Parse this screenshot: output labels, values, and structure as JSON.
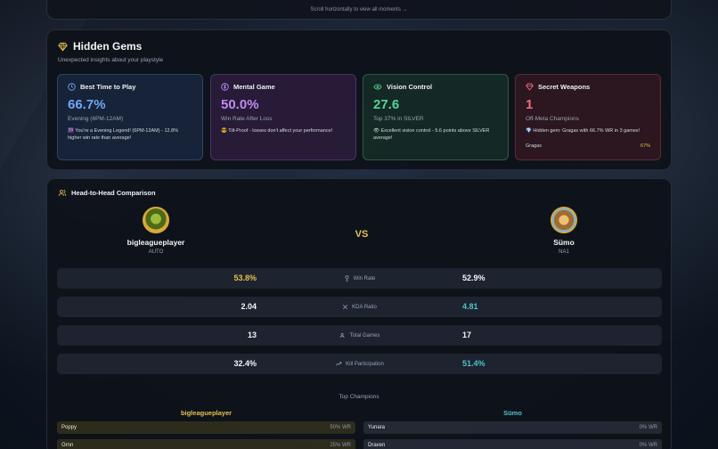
{
  "topbar": {
    "scroll_hint": "Scroll horizontally to view all moments →"
  },
  "gems": {
    "title": "Hidden Gems",
    "subtitle": "Unexpected insights about your playstyle",
    "cards": [
      {
        "title": "Best Time to Play",
        "value": "66.7%",
        "subtitle": "Evening (6PM-12AM)",
        "note": "🌆 You're a Evening Legend! (6PM-12AM) - 12.8% higher win rate than average!"
      },
      {
        "title": "Mental Game",
        "value": "50.0%",
        "subtitle": "Win Rate After Loss",
        "note": "😎 Tilt-Proof - losses don't affect your performance!"
      },
      {
        "title": "Vision Control",
        "value": "27.6",
        "subtitle": "Top 37% in SILVER",
        "note": "👁 Excellent vision control - 5.6 points above SILVER average!"
      },
      {
        "title": "Secret Weapons",
        "value": "1",
        "subtitle": "Off-Meta Champions",
        "note": "💎 Hidden gem: Gragas with 66.7% WR in 3 games!",
        "champion": "Gragas",
        "champion_wr": "67%"
      }
    ]
  },
  "h2h": {
    "title": "Head-to-Head Comparison",
    "vs": "VS",
    "player1": {
      "name": "bigleagueplayer",
      "region": "AUTO"
    },
    "player2": {
      "name": "Sümo",
      "region": "NA1"
    },
    "stats": [
      {
        "label": "Win Rate",
        "left": "53.8%",
        "right": "52.9%"
      },
      {
        "label": "KDA Ratio",
        "left": "2.04",
        "right": "4.81"
      },
      {
        "label": "Total Games",
        "left": "13",
        "right": "17"
      },
      {
        "label": "Kill Participation",
        "left": "32.4%",
        "right": "51.4%"
      }
    ],
    "top_champions_title": "Top Champions",
    "left_col_title": "bigleagueplayer",
    "right_col_title": "Sümo",
    "left_champs": [
      {
        "name": "Poppy",
        "wr": "50% WR"
      },
      {
        "name": "Ornn",
        "wr": "25% WR"
      }
    ],
    "right_champs": [
      {
        "name": "Yunara",
        "wr": "0% WR"
      },
      {
        "name": "Draven",
        "wr": "0% WR"
      }
    ]
  },
  "colors": {
    "gold": "#e6c04e",
    "teal": "#4fc3c8",
    "blue": "#6fa7f5",
    "purple": "#c08af0",
    "green": "#56d39a",
    "red": "#f06a7c"
  }
}
